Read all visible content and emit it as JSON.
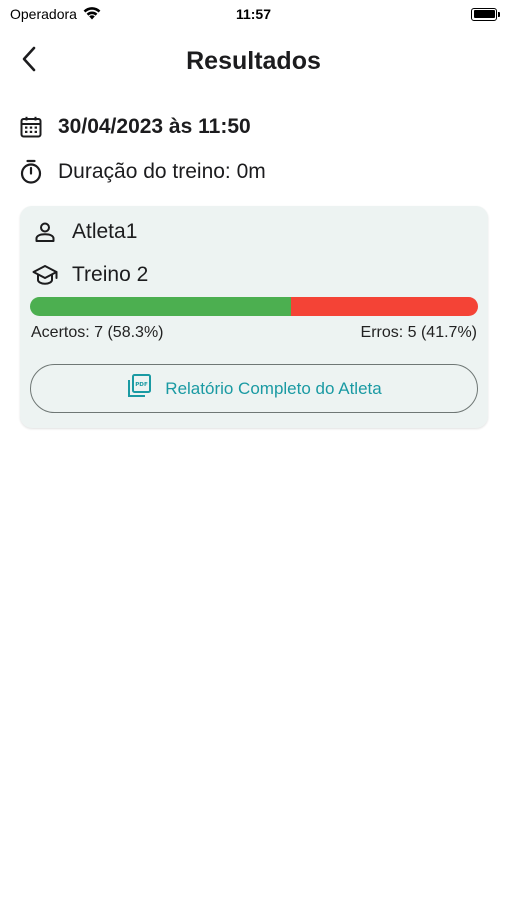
{
  "status_bar": {
    "carrier": "Operadora",
    "time": "11:57"
  },
  "header": {
    "title": "Resultados",
    "back_icon": "chevron-left-icon"
  },
  "session": {
    "date_icon": "calendar-icon",
    "datetime": "30/04/2023 às 11:50",
    "duration_icon": "stopwatch-icon",
    "duration": "Duração do treino: 0m"
  },
  "result_card": {
    "athlete_icon": "person-icon",
    "athlete": "Atleta1",
    "training_icon": "graduation-cap-icon",
    "training": "Treino 2",
    "correct_fraction": 0.583,
    "colors": {
      "correct": "#4caf50",
      "wrong": "#f44336",
      "accent": "#1a9aa3"
    },
    "correct_label": "Acertos: 7 (58.3%)",
    "wrong_label": "Erros: 5 (41.7%)",
    "report_icon": "pdf-icon",
    "report_button_label": "Relatório Completo do Atleta"
  }
}
